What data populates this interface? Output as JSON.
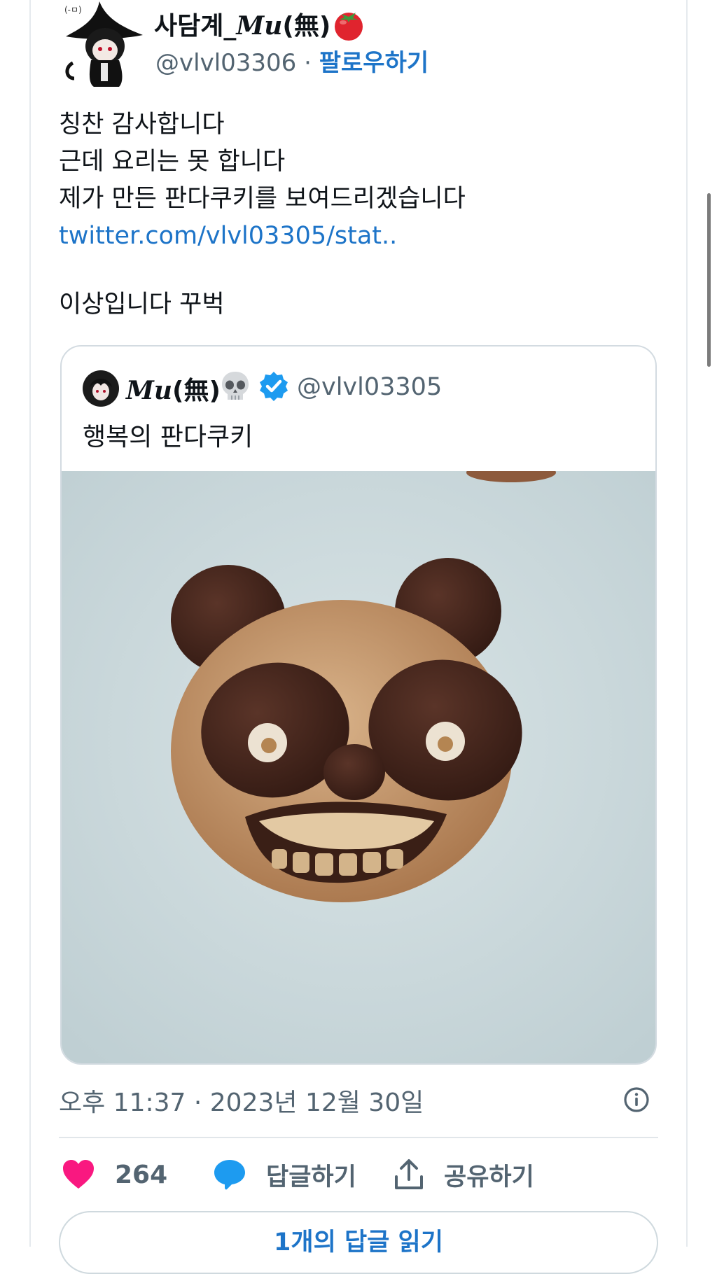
{
  "author": {
    "display_name_prefix": "사담계_",
    "display_name_mu": "Mu",
    "display_name_suffix": "(無)",
    "handle": "@vlvl03306",
    "separator": "·",
    "follow_label": "팔로우하기",
    "emoji_icon": "tomato-icon"
  },
  "tweet": {
    "lines": [
      "칭찬 감사합니다",
      "근데 요리는 못 합니다",
      "제가 만든 판다쿠키를 보여드리겠습니다"
    ],
    "link_text": "twitter.com/vlvl03305/stat..",
    "extra_line": "이상입니다 꾸벅"
  },
  "quote": {
    "display_name_mu": "Mu",
    "display_name_suffix": "(無)",
    "emoji_icon": "skull-icon",
    "verified": true,
    "verified_color": "#1d9bf0",
    "handle": "@vlvl03305",
    "text": "행복의 판다쿠키",
    "image_subject": "panda-cookie-photo"
  },
  "meta": {
    "timestamp": "오후 11:37 · 2023년 12월 30일"
  },
  "actions": {
    "like_count": "264",
    "like_color": "#f91880",
    "reply_label": "답글하기",
    "reply_color": "#1d9bf0",
    "share_label": "공유하기"
  },
  "read_replies_label": "1개의 답글 읽기",
  "colors": {
    "link": "#1d74c8",
    "secondary_text": "#536471"
  }
}
